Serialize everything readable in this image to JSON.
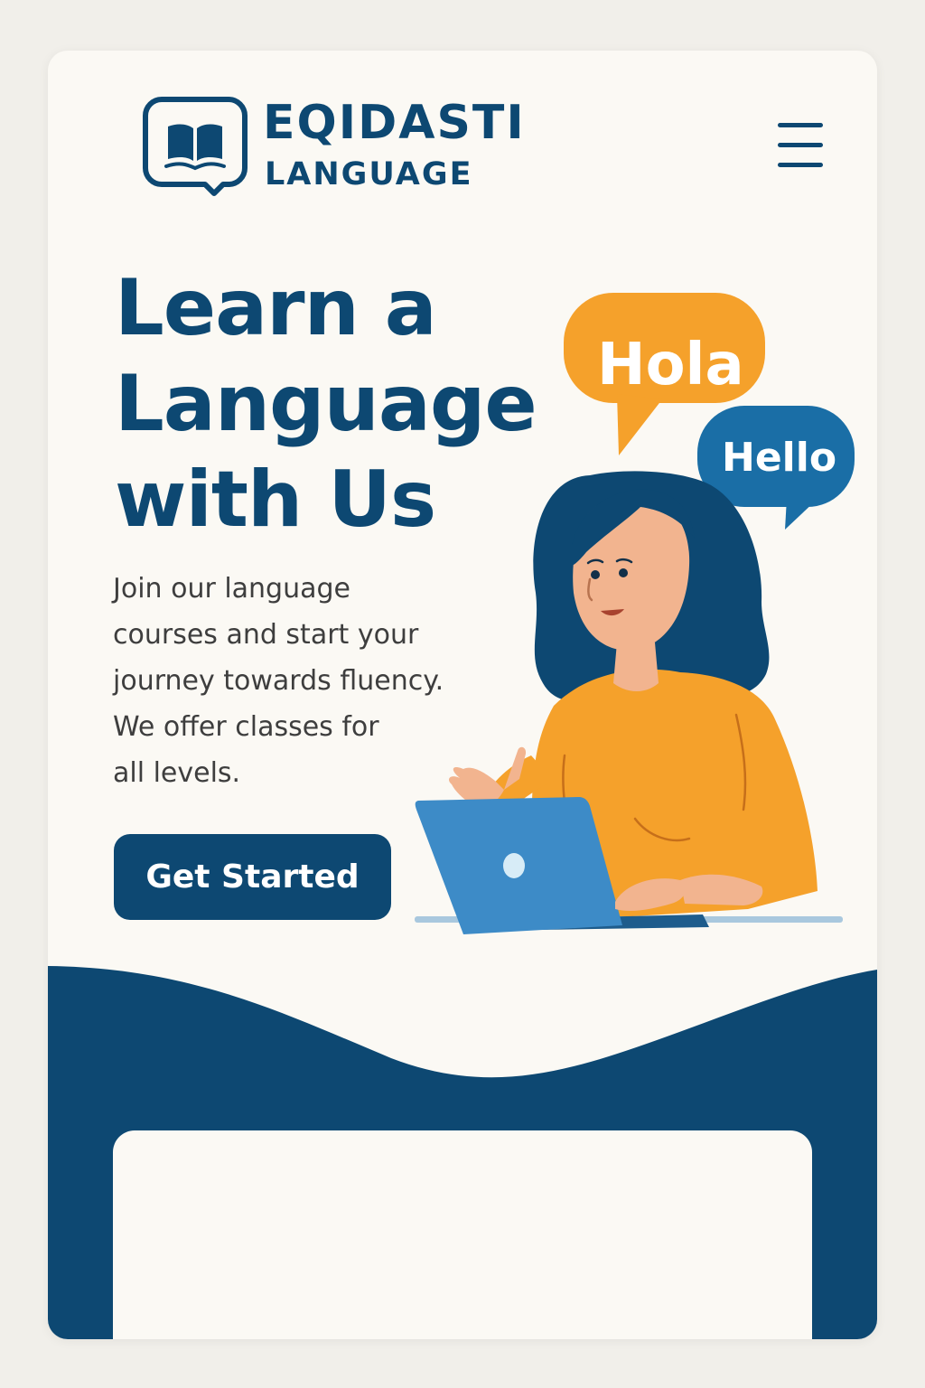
{
  "brand": {
    "name": "EQIDASTI",
    "sub": "LANGUAGE"
  },
  "hero": {
    "headline_lines": [
      "Learn a",
      "Language",
      "with Us"
    ],
    "body_lines": [
      "Join our language",
      "courses and start your",
      "journey towards fluency.",
      "We offer classes for",
      "all levels."
    ],
    "cta_label": "Get Started"
  },
  "illustration": {
    "bubble_left": "Hola",
    "bubble_right": "Hello"
  },
  "icons": {
    "logo": "book-in-speech-bubble-icon",
    "menu": "hamburger-menu-icon"
  },
  "colors": {
    "navy": "#0d4872",
    "orange": "#f5a12b",
    "blue": "#1a6ea6",
    "background": "#fbf9f4"
  }
}
